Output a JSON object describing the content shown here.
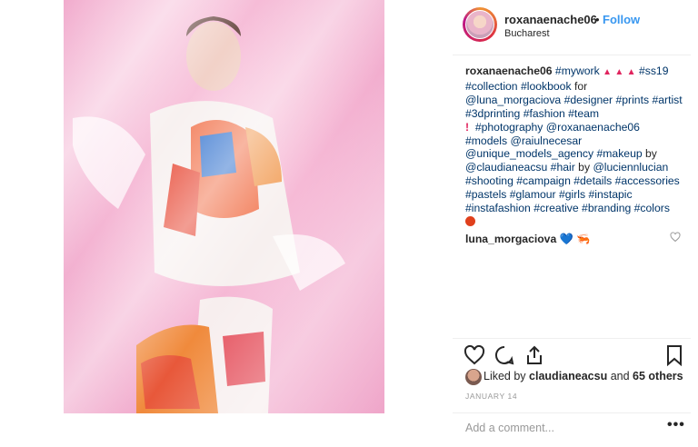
{
  "post": {
    "username": "roxanaenache06",
    "follow_label": "Follow",
    "separator": "•",
    "location": "Bucharest"
  },
  "caption": {
    "user": "roxanaenache06",
    "tags_1": "#mywork",
    "tri": "▲",
    "tags_2": "#ss19",
    "tags_3": "#collection #lookbook",
    "word_for": "for",
    "line_3": "@luna_morgaciova #designer #prints #artist",
    "line_4": "#3dprinting #fashion #team",
    "exclaim": "!",
    "line_5": "#photography @roxanaenache06",
    "line_6": "#models @raiulnecesar",
    "line_7a": "@unique_models_agency #makeup",
    "word_by": "by",
    "line_8a": "@claudianeacsu #hair",
    "line_8b": "@luciennlucian",
    "line_9": "#shooting #campaign #details #accessories",
    "line_10": "#pastels #glamour #girls #instapic",
    "line_11": "#instafashion #creative #branding #colors"
  },
  "comment": {
    "user": "luna_morgaciova",
    "emoji_heart": "💙",
    "emoji_shrimp": "🦐"
  },
  "likes": {
    "prefix": "Liked by",
    "user": "claudianeacsu",
    "and": "and",
    "count": "65 others"
  },
  "date": "JANUARY 14",
  "add_comment_placeholder": "Add a comment...",
  "more_label": "•••",
  "icons": [
    "heart-icon",
    "comment-icon",
    "share-icon",
    "bookmark-icon",
    "small-heart-icon"
  ],
  "colors": {
    "link": "#003569",
    "follow": "#3897f0",
    "accent_red": "#e0245e"
  }
}
